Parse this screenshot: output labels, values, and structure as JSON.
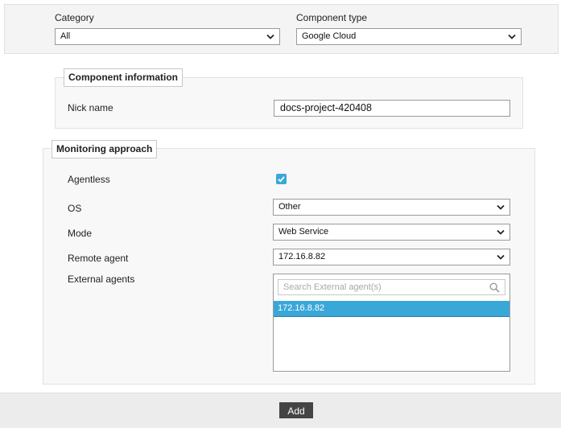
{
  "filters": {
    "category_label": "Category",
    "category_value": "All",
    "component_type_label": "Component type",
    "component_type_value": "Google Cloud"
  },
  "component_info": {
    "legend": "Component information",
    "nick_name_label": "Nick name",
    "nick_name_value": "docs-project-420408"
  },
  "monitoring": {
    "legend": "Monitoring approach",
    "agentless_label": "Agentless",
    "agentless_checked": true,
    "os_label": "OS",
    "os_value": "Other",
    "mode_label": "Mode",
    "mode_value": "Web Service",
    "remote_agent_label": "Remote agent",
    "remote_agent_value": "172.16.8.82",
    "external_agents_label": "External agents",
    "external_agents_search_placeholder": "Search External agent(s)",
    "external_agents_items": [
      "172.16.8.82"
    ]
  },
  "footer": {
    "add_label": "Add"
  },
  "colors": {
    "accent": "#3aa7d9",
    "button": "#444444"
  }
}
